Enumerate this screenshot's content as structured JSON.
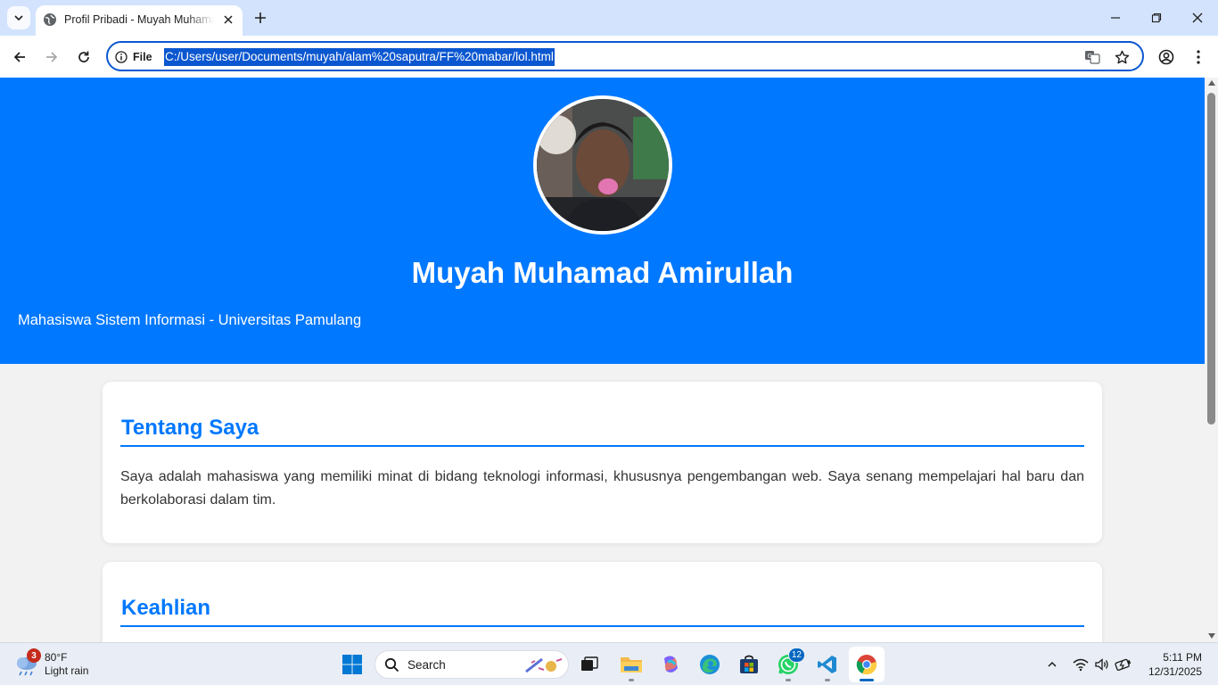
{
  "browser": {
    "tab_title": "Profil Pribadi - Muyah Muhamad Amirullah",
    "site_chip_label": "File",
    "url": "C:/Users/user/Documents/muyah/alam%20saputra/FF%20mabar/lol.html"
  },
  "page": {
    "hero": {
      "name": "Muyah Muhamad Amirullah",
      "subtitle": "Mahasiswa Sistem Informasi - Universitas Pamulang"
    },
    "sections": [
      {
        "title": "Tentang Saya",
        "text": "Saya adalah mahasiswa yang memiliki minat di bidang teknologi informasi, khususnya pengembangan web. Saya senang mempelajari hal baru dan berkolaborasi dalam tim."
      },
      {
        "title": "Keahlian"
      }
    ],
    "colors": {
      "hero_background": "#0078ff",
      "accent": "#0078ff",
      "page_background": "#f2f2f2"
    }
  },
  "taskbar": {
    "weather": {
      "badge_count": "3",
      "temperature": "80°F",
      "condition": "Light rain"
    },
    "search_label": "Search",
    "whatsapp_badge": "12",
    "clock": {
      "time": "5:11 PM",
      "date": "12/31/2025"
    },
    "apps": [
      "start-icon",
      "search-icon",
      "task-view-icon",
      "file-explorer-icon",
      "copilot-icon",
      "edge-icon",
      "microsoft-store-icon",
      "whatsapp-icon",
      "vscode-icon",
      "chrome-icon"
    ]
  }
}
